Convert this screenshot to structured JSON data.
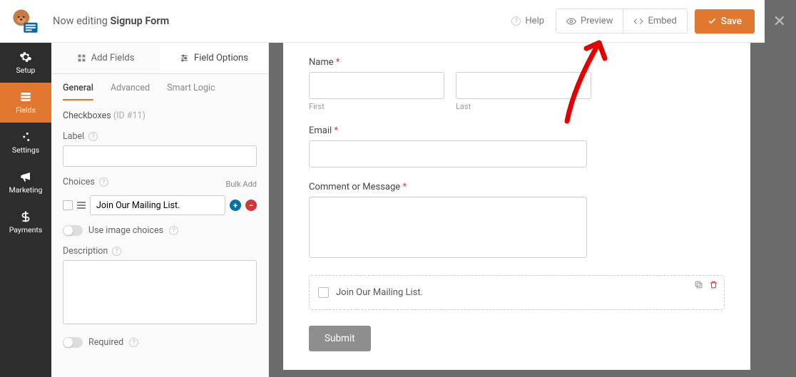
{
  "header": {
    "editing_prefix": "Now editing ",
    "form_name": "Signup Form",
    "help": "Help",
    "preview": "Preview",
    "embed": "Embed",
    "save": "Save"
  },
  "rail": {
    "setup": "Setup",
    "fields": "Fields",
    "settings": "Settings",
    "marketing": "Marketing",
    "payments": "Payments"
  },
  "sidebar": {
    "add_fields": "Add Fields",
    "field_options": "Field Options",
    "general": "General",
    "advanced": "Advanced",
    "smart_logic": "Smart Logic",
    "crumb_type": "Checkboxes",
    "crumb_id": "(ID #11)",
    "label_label": "Label",
    "label_value": "",
    "choices_label": "Choices",
    "bulk_add": "Bulk Add",
    "choice_value": "Join Our Mailing List.",
    "image_choices": "Use image choices",
    "description_label": "Description",
    "description_value": "",
    "required": "Required"
  },
  "form": {
    "name_label": "Name",
    "first": "First",
    "last": "Last",
    "email_label": "Email",
    "comment_label": "Comment or Message",
    "checkbox_label": "Join Our Mailing List.",
    "submit": "Submit"
  }
}
